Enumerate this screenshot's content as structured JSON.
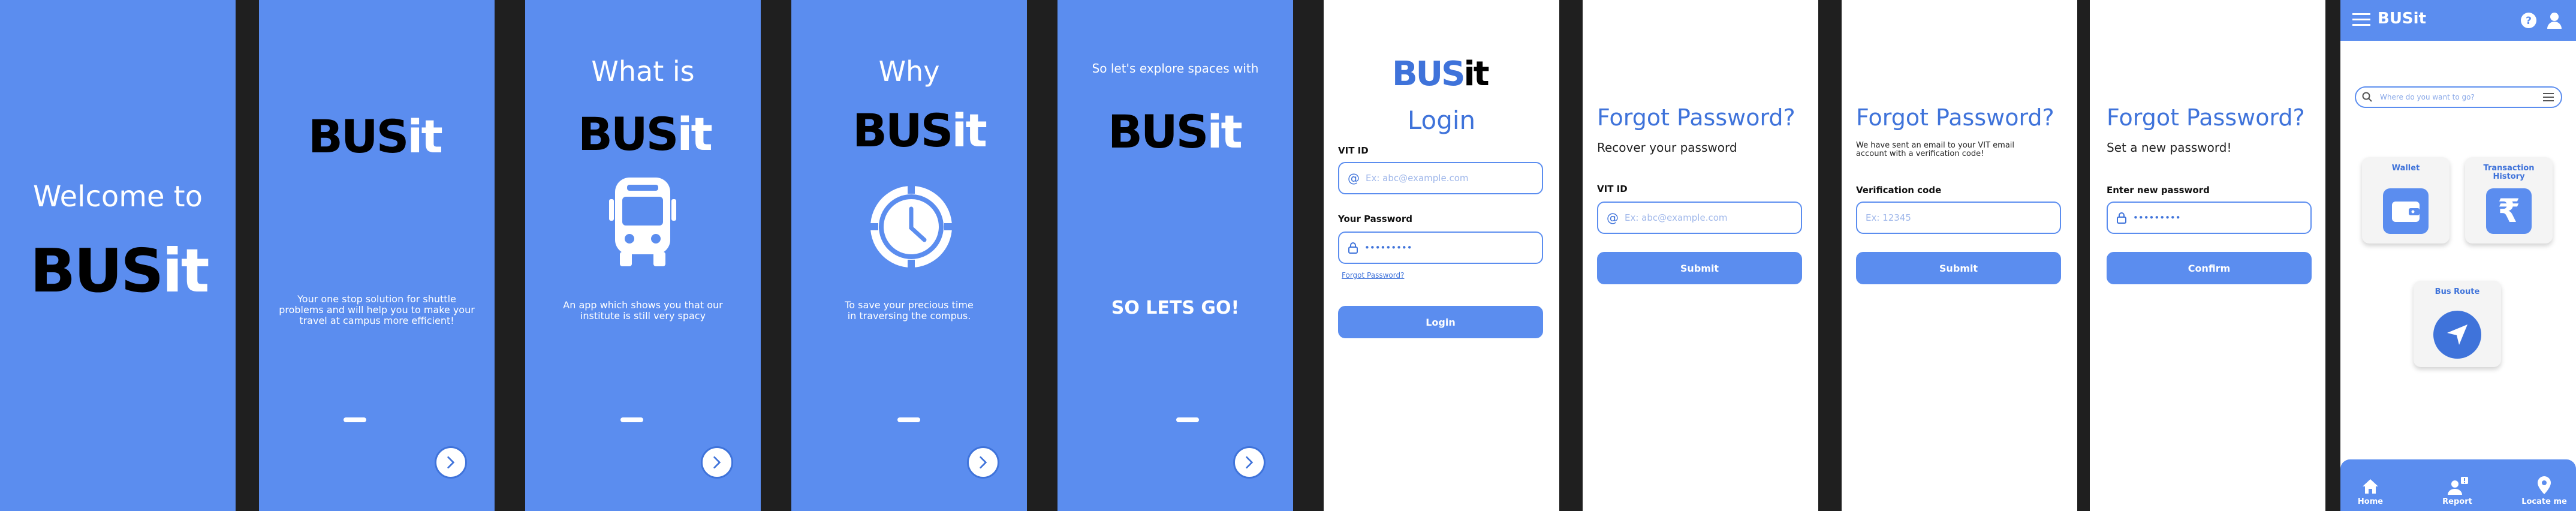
{
  "screens": {
    "welcome": {
      "line1": "Welcome to",
      "logo_a": "BUS",
      "logo_b": "it"
    },
    "intro1": {
      "logo_a": "BUS",
      "logo_b": "it",
      "desc": "Your one stop solution for shuttle problems and will help you to make your travel at campus more efficient!"
    },
    "intro2": {
      "heading": "What is",
      "logo_a": "BUS",
      "logo_b": "it",
      "desc": "An app which shows you that our institute is still very spacy"
    },
    "intro3": {
      "heading": "Why",
      "logo_a": "BUS",
      "logo_b": "it",
      "desc": "To save your precious time in traversing the compus."
    },
    "intro4": {
      "heading": "So let's explore spaces with",
      "logo_a": "BUS",
      "logo_b": "it",
      "cta": "SO LETS GO!"
    },
    "login": {
      "logo_a": "BUS",
      "logo_b": "it",
      "title": "Login",
      "vit_label": "VIT ID",
      "vit_placeholder": "Ex: abc@example.com",
      "pw_label": "Your Password",
      "pw_placeholder": "•••••••••",
      "forgot": "Forgot Password?",
      "button": "Login"
    },
    "forgot1": {
      "title": "Forgot Password?",
      "sub": "Recover your password",
      "label": "VIT ID",
      "placeholder": "Ex: abc@example.com",
      "button": "Submit"
    },
    "forgot2": {
      "title": "Forgot Password?",
      "sub": "We have sent an email to your VIT email account with a verification code!",
      "label": "Verification code",
      "placeholder": "Ex: 12345",
      "button": "Submit"
    },
    "forgot3": {
      "title": "Forgot Password?",
      "sub": "Set a new password!",
      "label": "Enter new password",
      "placeholder": "•••••••••",
      "button": "Confirm"
    },
    "home": {
      "app_title": "BUSit",
      "search_placeholder": "Where do you want to go?",
      "tiles": [
        {
          "label": "Wallet"
        },
        {
          "label": "Transaction History"
        },
        {
          "label": "Bus Route"
        }
      ],
      "nav": [
        {
          "label": "Home"
        },
        {
          "label": "Report"
        },
        {
          "label": "Locate me"
        }
      ]
    }
  },
  "colors": {
    "primary": "#5b8def",
    "accent": "#3f73da",
    "tile_bg": "#f4f4f4",
    "bezel": "#1f1f1f"
  }
}
